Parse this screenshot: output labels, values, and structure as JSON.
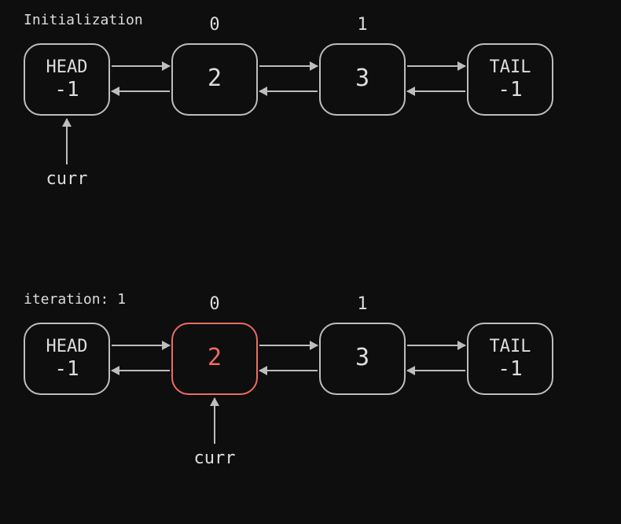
{
  "stages": [
    {
      "caption": "Initialization",
      "nodes": [
        {
          "label": "HEAD",
          "value": "-1",
          "index": null,
          "highlight": false
        },
        {
          "label": null,
          "value": "2",
          "index": "0",
          "highlight": false
        },
        {
          "label": null,
          "value": "3",
          "index": "1",
          "highlight": false
        },
        {
          "label": "TAIL",
          "value": "-1",
          "index": null,
          "highlight": false
        }
      ],
      "pointer": {
        "label": "curr",
        "targetNode": 0
      }
    },
    {
      "caption": "iteration: 1",
      "nodes": [
        {
          "label": "HEAD",
          "value": "-1",
          "index": null,
          "highlight": false
        },
        {
          "label": null,
          "value": "2",
          "index": "0",
          "highlight": true
        },
        {
          "label": null,
          "value": "3",
          "index": "1",
          "highlight": false
        },
        {
          "label": "TAIL",
          "value": "-1",
          "index": null,
          "highlight": false
        }
      ],
      "pointer": {
        "label": "curr",
        "targetNode": 1
      }
    }
  ],
  "layout": {
    "nodeX": [
      30,
      218,
      406,
      594
    ],
    "nodeW": 110,
    "nodeTop": 40,
    "stageTop": [
      15,
      370
    ],
    "gapArrowFwdTop": 68,
    "gapArrowRevTop": 100,
    "pointerArrowH": 58,
    "pointerGap": 4
  }
}
